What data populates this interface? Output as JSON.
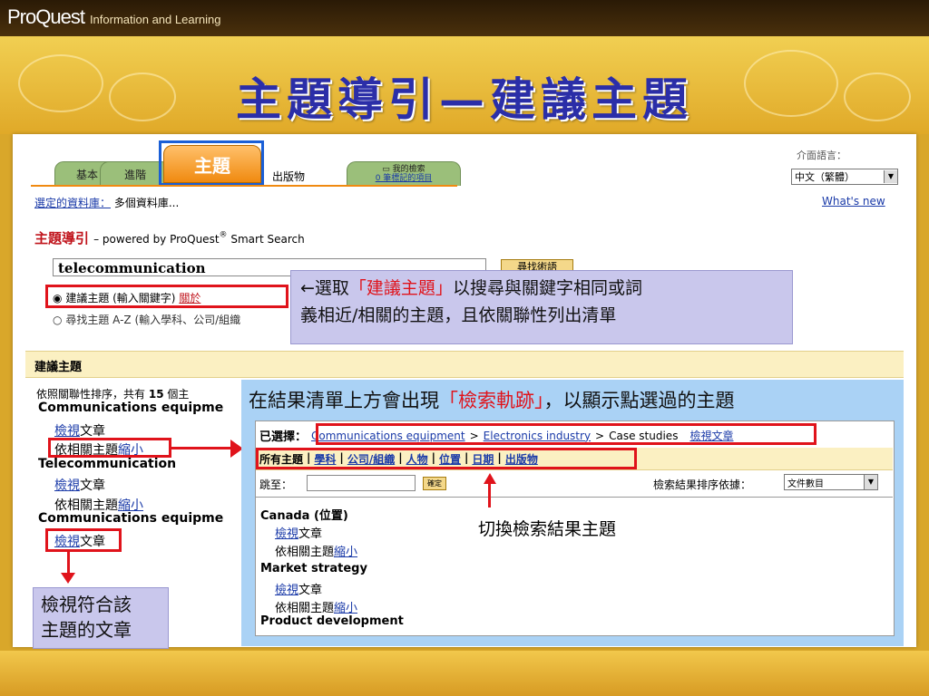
{
  "header": {
    "logo_brand": "ProQuest",
    "logo_tag": "Information and Learning"
  },
  "slide_title": "主題導引—建議主題",
  "tabs": {
    "basic": "基本",
    "advanced": "進階",
    "topic": "主題",
    "publications": "出版物",
    "my_search": "我的檢索",
    "marked": "0 筆標記的項目"
  },
  "interface_language": {
    "label": "介面語言：",
    "selected": "中文（繁體）"
  },
  "database": {
    "label": "選定的資料庫：",
    "value": "多個資料庫...",
    "whats_new": "What's new"
  },
  "topic_guide": {
    "title": "主題導引",
    "powered": "– powered by ProQuest",
    "reg": "®",
    "smart": " Smart Search"
  },
  "search": {
    "value": "telecommunication",
    "button": "尋找術語"
  },
  "options": {
    "suggest": "建議主題 (輸入關鍵字)",
    "about": "關於",
    "az": "尋找主題 A-Z (輸入學科、公司/組織"
  },
  "note1": {
    "arrow": "←選取",
    "q1": "「建議主題」",
    "text1": "以搜尋與關鍵字相同或詞",
    "text2": "義相近/相關的主題，且依關聯性列出清單"
  },
  "suggest_header": "建議主題",
  "results": {
    "sort_prefix": "依照關聯性排序，共有",
    "count": "15",
    "sort_suffix": "個主",
    "items": [
      {
        "title": "Communications equipme",
        "view": "檢視",
        "view_rest": "文章",
        "related": "依相關主題",
        "narrow": "縮小"
      },
      {
        "title": "Telecommunication",
        "view": "檢視",
        "view_rest": "文章",
        "related": "依相關主題",
        "narrow": "縮小"
      },
      {
        "title": "Communications equipme",
        "view": "檢視",
        "view_rest": "文章"
      }
    ]
  },
  "note2": {
    "t1": "在結果清單上方會出現",
    "q": "「檢索軌跡」",
    "t2": "，以顯示點選過的主題"
  },
  "trail": {
    "label": "已選擇：",
    "items": [
      "Communications equipment",
      "Electronics industry",
      "Case studies"
    ],
    "sep": ">",
    "view": "檢視文章"
  },
  "filters": [
    "所有主題",
    "學科",
    "公司/組織",
    "人物",
    "位置",
    "日期",
    "出版物"
  ],
  "jump": {
    "label": "跳至：",
    "button": "確定",
    "sort_label": "檢索結果排序依據：",
    "sort_value": "文件數目"
  },
  "inner_results": [
    {
      "title": "Canada (位置)",
      "view": "檢視",
      "view_rest": "文章",
      "related": "依相關主題",
      "narrow": "縮小"
    },
    {
      "title": "Market strategy",
      "view": "檢視",
      "view_rest": "文章",
      "related": "依相關主題",
      "narrow": "縮小"
    },
    {
      "title": "Product development"
    }
  ],
  "note3": "切換檢索結果主題",
  "note4": {
    "line1": "檢視符合該",
    "line2": "主題的文章"
  }
}
